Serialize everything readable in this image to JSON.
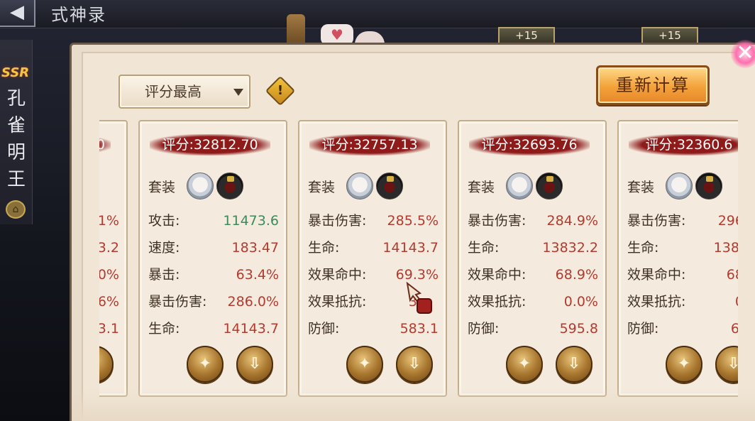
{
  "window": {
    "back_symbol": "◀",
    "title": "式神录",
    "level_tags": [
      "+15",
      "+15"
    ]
  },
  "side": {
    "rarity": "SSR",
    "name": "孔雀明王",
    "lock_symbol": "⌂"
  },
  "toolbar": {
    "sort_value": "评分最高",
    "info_symbol": "!",
    "recalc_label": "重新计算",
    "close_symbol": "✕"
  },
  "cards": [
    {
      "score": "0",
      "stats": [
        {
          "label": "",
          "value": "1%"
        },
        {
          "label": "",
          "value": "3.2"
        },
        {
          "label": "",
          "value": "0%"
        },
        {
          "label": "",
          "value": "6%"
        },
        {
          "label": "",
          "value": "3.1"
        }
      ]
    },
    {
      "score": "评分:32812.70",
      "set_label": "套装",
      "stats": [
        {
          "label": "攻击:",
          "value": "11473.6",
          "highlight": true
        },
        {
          "label": "速度:",
          "value": "183.47"
        },
        {
          "label": "暴击:",
          "value": "63.4%"
        },
        {
          "label": "暴击伤害:",
          "value": "286.0%"
        },
        {
          "label": "生命:",
          "value": "14143.7"
        }
      ]
    },
    {
      "score": "评分:32757.13",
      "set_label": "套装",
      "stats": [
        {
          "label": "暴击伤害:",
          "value": "285.5%"
        },
        {
          "label": "生命:",
          "value": "14143.7"
        },
        {
          "label": "效果命中:",
          "value": "69.3%"
        },
        {
          "label": "效果抵抗:",
          "value": "3"
        },
        {
          "label": "防御:",
          "value": "583.1"
        }
      ]
    },
    {
      "score": "评分:32693.76",
      "set_label": "套装",
      "stats": [
        {
          "label": "暴击伤害:",
          "value": "284.9%"
        },
        {
          "label": "生命:",
          "value": "13832.2"
        },
        {
          "label": "效果命中:",
          "value": "68.9%"
        },
        {
          "label": "效果抵抗:",
          "value": "0.0%"
        },
        {
          "label": "防御:",
          "value": "595.8"
        }
      ]
    },
    {
      "score": "评分:32360.6",
      "set_label": "套装",
      "stats": [
        {
          "label": "暴击伤害:",
          "value": "296."
        },
        {
          "label": "生命:",
          "value": "1383"
        },
        {
          "label": "效果命中:",
          "value": "68."
        },
        {
          "label": "效果抵抗:",
          "value": "0."
        },
        {
          "label": "防御:",
          "value": "61"
        }
      ]
    }
  ],
  "card_buttons": {
    "replace_symbol": "✦",
    "apply_symbol": "⇩"
  },
  "colors": {
    "score_band": "#8e1a1a",
    "stat_value": "#b23b30",
    "stat_value_highlight": "#3c8a5c",
    "recalc_button": "#f3a23a"
  }
}
